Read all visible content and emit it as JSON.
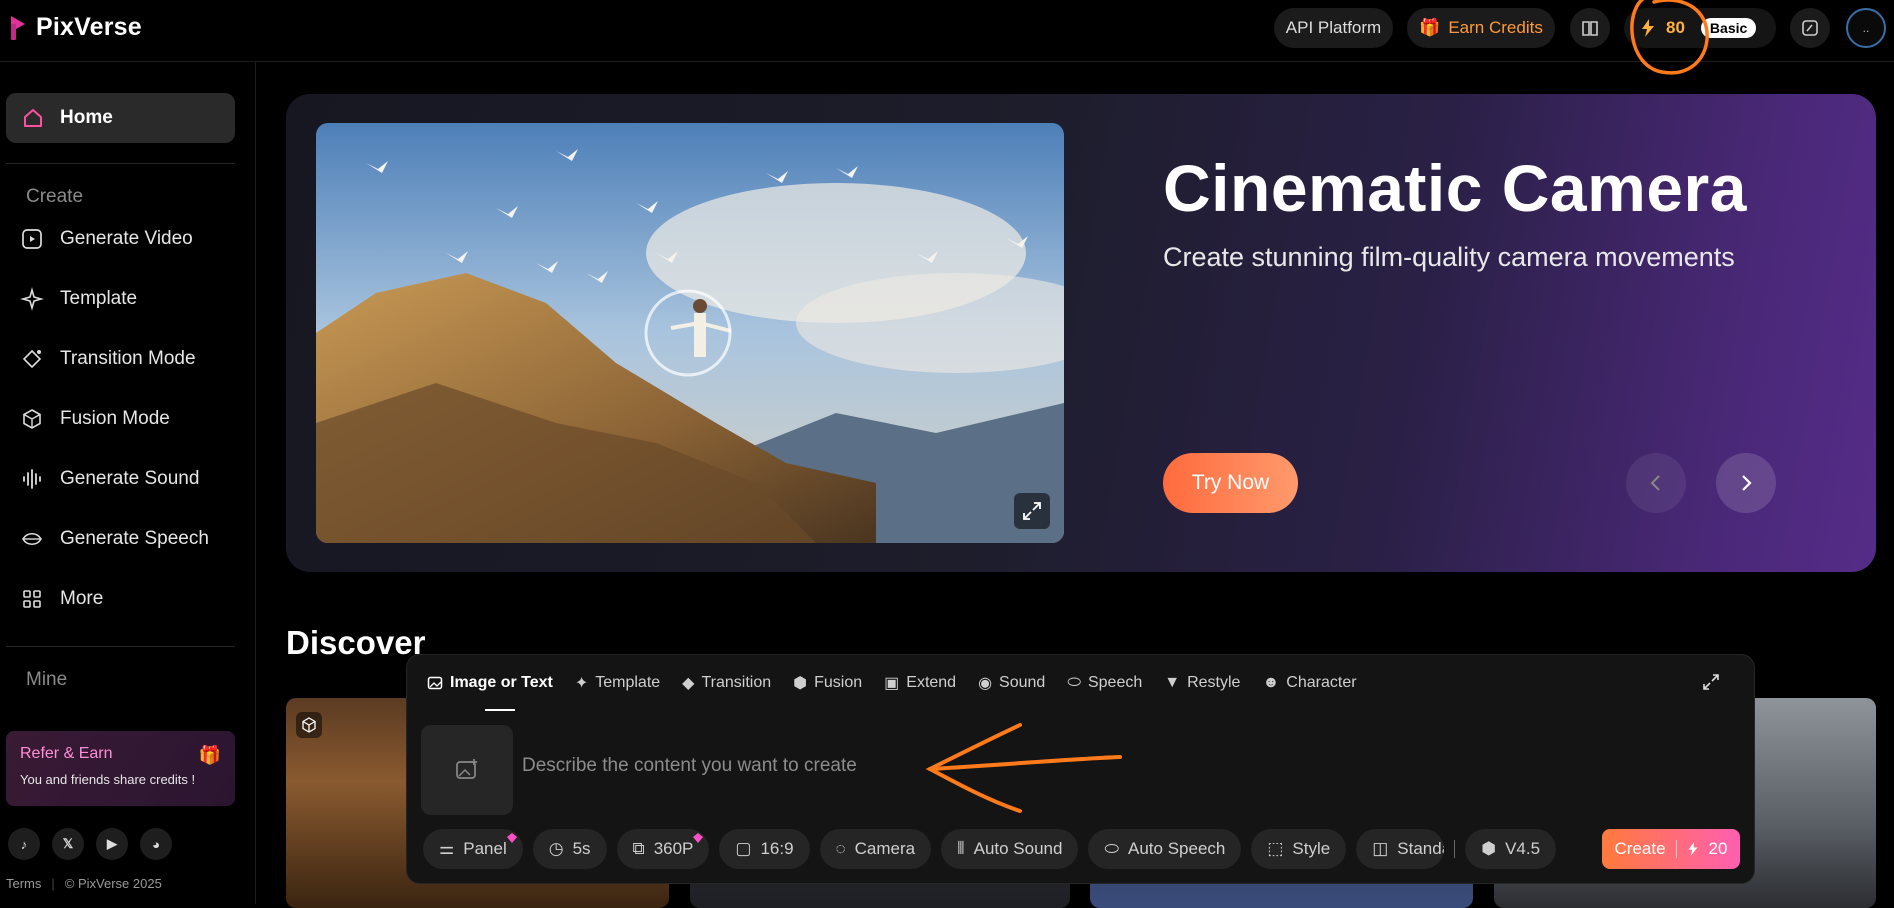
{
  "header": {
    "brand": "PixVerse",
    "api_platform": "API Platform",
    "earn_credits": "Earn Credits",
    "credits": "80",
    "plan": "Basic",
    "avatar_text": "..",
    "brand_color": "#e0339a",
    "credit_color": "#ffb13d"
  },
  "sidebar": {
    "home": "Home",
    "create_section": "Create",
    "items": [
      {
        "label": "Generate Video",
        "icon": "video-icon"
      },
      {
        "label": "Template",
        "icon": "template-icon"
      },
      {
        "label": "Transition Mode",
        "icon": "transition-icon"
      },
      {
        "label": "Fusion Mode",
        "icon": "fusion-icon"
      },
      {
        "label": "Generate Sound",
        "icon": "sound-icon"
      },
      {
        "label": "Generate Speech",
        "icon": "speech-icon"
      },
      {
        "label": "More",
        "icon": "grid-icon"
      }
    ],
    "mine_section": "Mine",
    "refer_title": "Refer & Earn",
    "refer_sub": "You and friends share credits !",
    "socials": [
      "tiktok",
      "x",
      "youtube",
      "discord"
    ],
    "footer_terms": "Terms",
    "footer_copy": "© PixVerse 2025"
  },
  "hero": {
    "title": "Cinematic Camera",
    "subtitle": "Create stunning film-quality camera movements",
    "cta": "Try Now"
  },
  "discover": {
    "title": "Discover"
  },
  "composer": {
    "tabs": [
      "Image or Text",
      "Template",
      "Transition",
      "Fusion",
      "Extend",
      "Sound",
      "Speech",
      "Restyle",
      "Character"
    ],
    "placeholder": "Describe the content you want to create",
    "chips": {
      "panel": "Panel",
      "duration": "5s",
      "quality": "360P",
      "ratio": "16:9",
      "camera": "Camera",
      "auto_sound": "Auto Sound",
      "auto_speech": "Auto Speech",
      "style": "Style",
      "standard": "Standa",
      "version": "V4.5"
    },
    "create_label": "Create",
    "create_cost": "20"
  }
}
